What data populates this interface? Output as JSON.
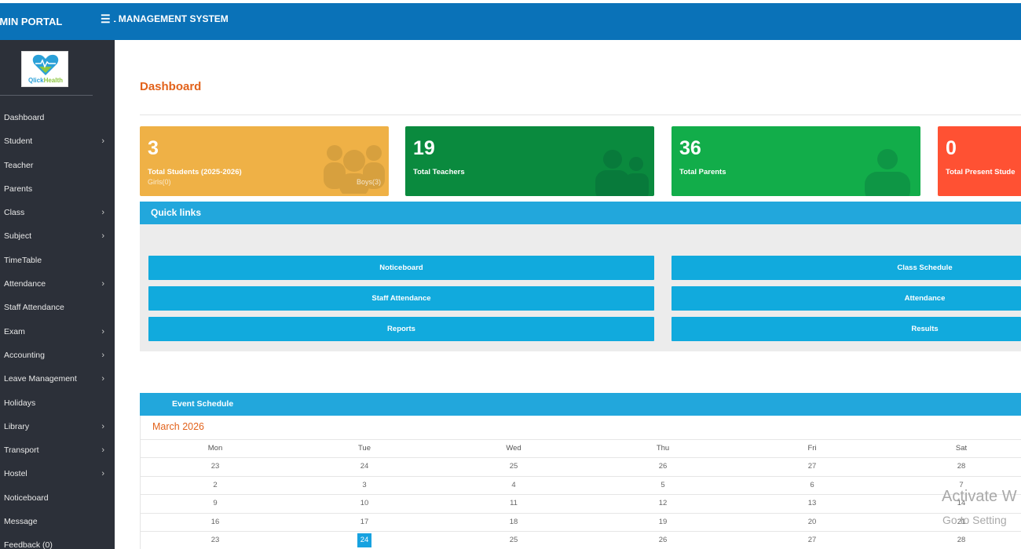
{
  "header": {
    "brand": "DMIN PORTAL",
    "menu_icon": "hamburger-icon",
    "app_title": "OL MANAGEMENT SYSTEM"
  },
  "logo": {
    "text_q": "Qlick",
    "text_h": "Health"
  },
  "sidebar": {
    "items": [
      {
        "label": "Dashboard",
        "has_chevron": false
      },
      {
        "label": "Student",
        "has_chevron": true
      },
      {
        "label": "Teacher",
        "has_chevron": false
      },
      {
        "label": "Parents",
        "has_chevron": false
      },
      {
        "label": "Class",
        "has_chevron": true
      },
      {
        "label": "Subject",
        "has_chevron": true
      },
      {
        "label": "TimeTable",
        "has_chevron": false
      },
      {
        "label": "Attendance",
        "has_chevron": true
      },
      {
        "label": "Staff Attendance",
        "has_chevron": false
      },
      {
        "label": "Exam",
        "has_chevron": true
      },
      {
        "label": "Accounting",
        "has_chevron": true
      },
      {
        "label": "Leave Management",
        "has_chevron": true
      },
      {
        "label": "Holidays",
        "has_chevron": false
      },
      {
        "label": "Library",
        "has_chevron": true
      },
      {
        "label": "Transport",
        "has_chevron": true
      },
      {
        "label": "Hostel",
        "has_chevron": true
      },
      {
        "label": "Noticeboard",
        "has_chevron": false
      },
      {
        "label": "Message",
        "has_chevron": false
      },
      {
        "label": "Feedback (0)",
        "has_chevron": false
      }
    ]
  },
  "main": {
    "title": "Dashboard"
  },
  "stats": {
    "students": {
      "value": "3",
      "label": "Total Students (2025-2026)",
      "girls": "Girls(0)",
      "boys": "Boys(3)",
      "color": "#efb146"
    },
    "teachers": {
      "value": "19",
      "label": "Total Teachers",
      "color": "#0a8a3e"
    },
    "parents": {
      "value": "36",
      "label": "Total Parents",
      "color": "#12ad4a"
    },
    "present": {
      "value": "0",
      "label": "Total Present Stude",
      "color": "#ff5133"
    }
  },
  "quick_links": {
    "title": "Quick links",
    "noticeboard": "Noticeboard",
    "class_schedule": "Class Schedule",
    "staff_attendance": "Staff Attendance",
    "attendance": "Attendance",
    "reports": "Reports",
    "results": "Results"
  },
  "event_schedule": {
    "title": "Event Schedule",
    "month": "March 2026",
    "days": [
      "Mon",
      "Tue",
      "Wed",
      "Thu",
      "Fri",
      "Sat"
    ],
    "weeks": [
      [
        "23",
        "24",
        "25",
        "26",
        "27",
        "28"
      ],
      [
        "2",
        "3",
        "4",
        "5",
        "6",
        "7"
      ],
      [
        "9",
        "10",
        "11",
        "12",
        "13",
        "14"
      ],
      [
        "16",
        "17",
        "18",
        "19",
        "20",
        "21"
      ],
      [
        "23",
        "24",
        "25",
        "26",
        "27",
        "28"
      ]
    ],
    "today": "24"
  },
  "watermark": {
    "line1": "Activate W",
    "line2": "Go to Setting"
  }
}
